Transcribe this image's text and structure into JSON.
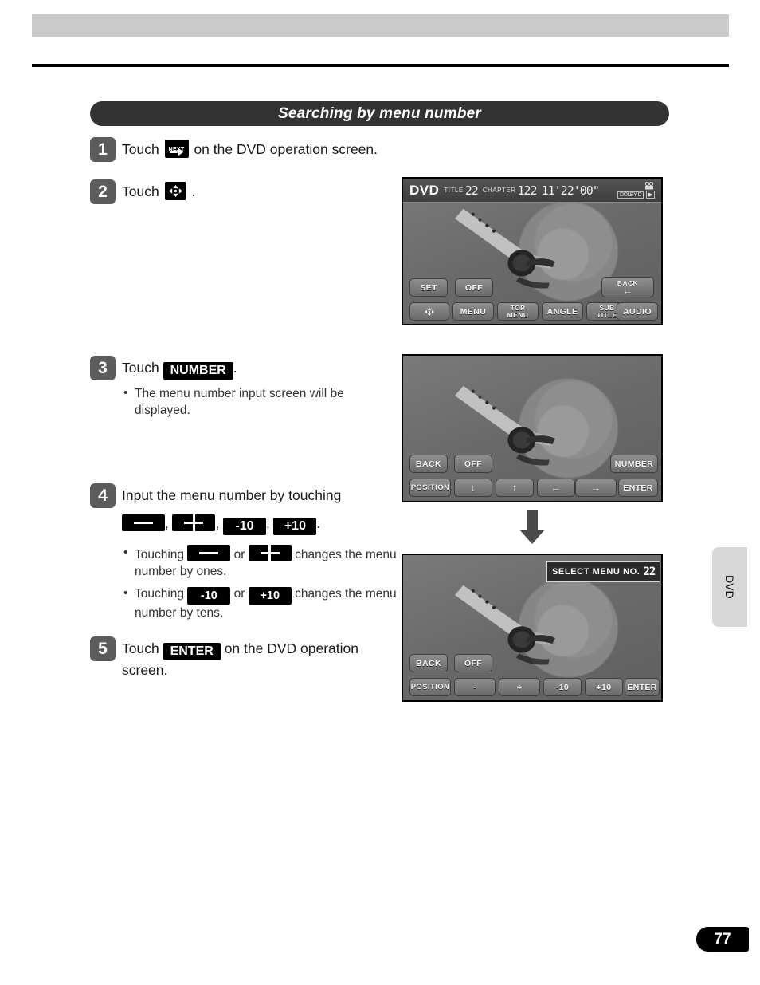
{
  "page": {
    "number": "77",
    "side_tab_label": "DVD"
  },
  "section": {
    "title": "Searching by menu number"
  },
  "steps": [
    {
      "num": "1",
      "text_before": "Touch",
      "icon": "next-arrow-icon",
      "icon_label": "NEXT",
      "text_after": "on the DVD operation screen."
    },
    {
      "num": "2",
      "text_before": "Touch",
      "icon": "four-way-arrow-pad-icon",
      "text_after": "."
    },
    {
      "num": "3",
      "text_before": "Touch",
      "key": "NUMBER",
      "text_after": ".",
      "notes": [
        "The menu number input screen will be displayed."
      ]
    },
    {
      "num": "4",
      "text": "Input the menu number by touching",
      "keys": [
        "—",
        "+",
        "-10",
        "+10"
      ],
      "keys_trailing": ".",
      "notes": [
        {
          "lead": "Touching",
          "key_a": "—",
          "mid": "or",
          "key_b": "+",
          "tail": "changes the menu number by ones."
        },
        {
          "lead": "Touching",
          "key_a": "-10",
          "mid": "or",
          "key_b": "+10",
          "tail": "changes the menu number by tens."
        }
      ]
    },
    {
      "num": "5",
      "text_before": "Touch",
      "key": "ENTER",
      "text_after": "on the DVD operation screen."
    }
  ],
  "screens": [
    {
      "name": "dvd-operation-screen",
      "statusbar": {
        "source": "DVD",
        "title_label": "TITLE",
        "title_value": "22",
        "chapter_label": "CHAPTER",
        "chapter_value": "122",
        "time_value": "11'22'00\"",
        "chip_dolby": "DOLBY D",
        "chip_play": "▶"
      },
      "buttons_row1": [
        {
          "label": "SET"
        },
        {
          "label": "OFF"
        },
        {
          "label": "BACK",
          "sub": "←"
        }
      ],
      "buttons_row2": [
        {
          "label": "pad",
          "icon": "four-way-arrow-pad-icon"
        },
        {
          "label": "MENU"
        },
        {
          "label": "TOP",
          "sub": "MENU"
        },
        {
          "label": "ANGLE"
        },
        {
          "label": "SUB",
          "sub": "TITLE"
        },
        {
          "label": "AUDIO"
        }
      ]
    },
    {
      "name": "dvd-menu-control-screen",
      "buttons_row1": [
        {
          "label": "BACK"
        },
        {
          "label": "OFF"
        },
        {
          "label": "NUMBER"
        }
      ],
      "buttons_row2": [
        {
          "label": "POSITION"
        },
        {
          "label": "↓"
        },
        {
          "label": "↑"
        },
        {
          "label": "←"
        },
        {
          "label": "→"
        },
        {
          "label": "ENTER"
        }
      ]
    },
    {
      "name": "menu-number-input-screen",
      "overlay": {
        "label": "SELECT MENU NO.",
        "value": "22"
      },
      "buttons_row1": [
        {
          "label": "BACK"
        },
        {
          "label": "OFF"
        }
      ],
      "buttons_row2": [
        {
          "label": "POSITION"
        },
        {
          "label": "-"
        },
        {
          "label": "+"
        },
        {
          "label": "-10"
        },
        {
          "label": "+10"
        },
        {
          "label": "ENTER"
        }
      ]
    }
  ]
}
